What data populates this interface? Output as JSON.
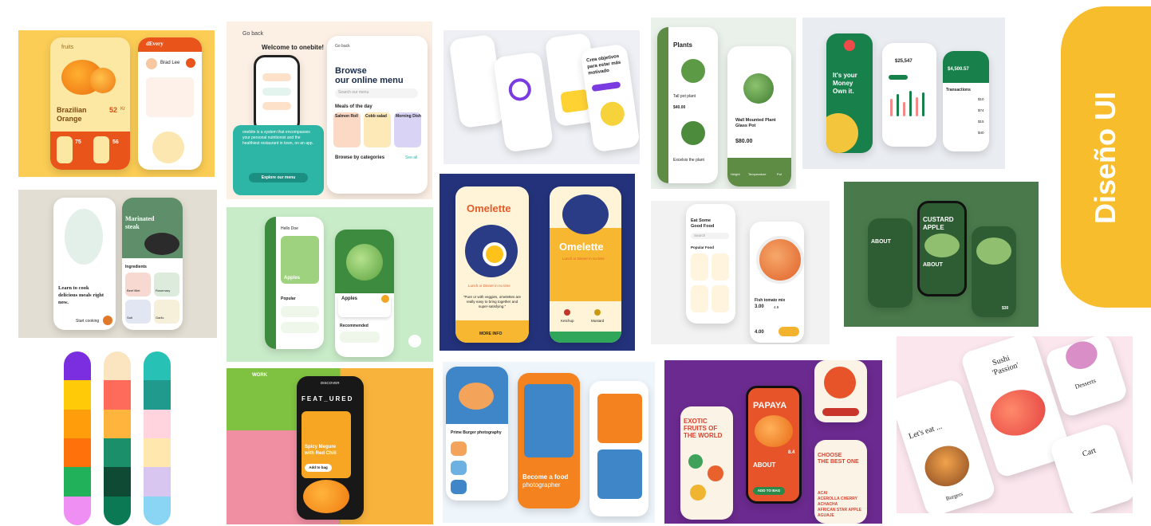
{
  "banner": {
    "title": "Diseño UI",
    "color": "#f7bd2c"
  },
  "tile_fruits": {
    "back_label": "fruits",
    "product_line1": "Brazilian",
    "product_line2": "Orange",
    "price": "52",
    "price_unit": "Kr",
    "stat_a": "75",
    "stat_b": "56",
    "delivery_brand": "dEvery",
    "courier_name": "Brad Lee"
  },
  "tile_onebite": {
    "back_label": "Go back",
    "welcome": "Welcome to onebite!",
    "body_text": "onebite is a system that encompasses your personal nutritionist and the healthiest restaurant in town, on an app.",
    "cta": "Explore our menu",
    "browse_line1": "Browse",
    "browse_line2": "our online menu",
    "search_placeholder": "Search our menu",
    "meals_heading": "Meals of the day",
    "meals": [
      "Salmon Roll",
      "Cobb salad",
      "Morning Dish"
    ],
    "categories_heading": "Browse by categories",
    "see_all": "See all"
  },
  "tile_goals": {
    "heading_line1": "Crea objetivos",
    "heading_line2": "para estar más",
    "heading_line3": "motivado"
  },
  "tile_plants": {
    "heading": "Plants",
    "items": [
      "Tall pot plant",
      "Excelsis the plant",
      "Wall Mounted Plant Glass Pot"
    ],
    "price_small": "$40.00",
    "price_big": "$80.00",
    "stat_labels": [
      "Height",
      "Temperature",
      "Pot"
    ]
  },
  "tile_money": {
    "tagline_line1": "It's your",
    "tagline_line2": "Money",
    "tagline_line3": "Own it.",
    "current_balance": "$25,547",
    "big_balance": "$4,500.57",
    "transactions_heading": "Transactions",
    "amounts": [
      "$10",
      "$74",
      "$15",
      "$40"
    ]
  },
  "tile_steak": {
    "title_line1": "Marinated",
    "title_line2": "steak",
    "left_text_line1": "Learn to cook",
    "left_text_line2": "delicious meals right",
    "left_text_line3": "now.",
    "cta": "Start cooking",
    "ingredients_heading": "Ingredients",
    "ingredients": [
      "Beef fillet",
      "Rosemary",
      "Salt",
      "Garlic"
    ]
  },
  "tile_apples": {
    "greeting": "Hello Doe",
    "product": "Apples",
    "product_card": "Apples",
    "section_popular": "Popular",
    "section_recommended": "Recommended"
  },
  "tile_omelette": {
    "title": "Omelette",
    "subtitle": "Lunch or Dinner in no time",
    "quote": "\"Pure or with veggies, omelettes are really easy to bring together and super-satisfying.\"",
    "more_info": "MORE INFO",
    "ingredient_a": "Ketchup",
    "ingredient_b": "Mustard"
  },
  "tile_goodfood": {
    "heading_line1": "Eat Some",
    "heading_line2": "Good Food",
    "search": "Search",
    "popular": "Popular Food",
    "dish": "Fish tomato mix",
    "price": "3.00",
    "rating": "4.9",
    "total": "4.00"
  },
  "tile_custard": {
    "title_line1": "CUSTARD",
    "title_line2": "APPLE",
    "about": "ABOUT",
    "price": "$30"
  },
  "tile_featured": {
    "nav": "WORK",
    "brand": "FEAT_URED",
    "dish_line1": "Spicy Megure",
    "dish_line2": "with Red Chili",
    "add": "Add to bag",
    "discover": "DISCOVER"
  },
  "tile_burger": {
    "heading": "Prime Burger photography",
    "cta_line1": "Become a food",
    "cta_line2": "photographer"
  },
  "tile_papaya": {
    "title_line1": "EXOTIC",
    "title_line2": "FRUITS OF",
    "title_line3": "THE WORLD",
    "product": "PAPAYA",
    "price": "8.4",
    "about": "ABOUT",
    "choose_line1": "CHOOSE",
    "choose_line2": "THE BEST ONE",
    "fruit_list": [
      "ACAI",
      "ACEROLLA CHERRY",
      "ACHACHA",
      "AFRICAN STAR APPLE",
      "AGUAJE"
    ],
    "button": "ADD TO BAG"
  },
  "tile_sushi": {
    "sushi_line1": "Sushi",
    "sushi_line2": "'Passion'",
    "lets_eat": "Let's eat ...",
    "burgers": "Burgers",
    "desserts": "Desserts",
    "cart": "Cart"
  },
  "palettes": [
    [
      "#7a2ee0",
      "#ffcb08",
      "#ff9d0b",
      "#ff720b",
      "#20b15a",
      "#ef8ef3"
    ],
    [
      "#fbe5c0",
      "#ff6b5b",
      "#ffb43d",
      "#1a8f6a",
      "#0e4a34",
      "#0b7a54"
    ],
    [
      "#27c2b5",
      "#1f9a8d",
      "#ffd4df",
      "#ffe7ad",
      "#d8c6f0",
      "#8ad4f4"
    ]
  ]
}
